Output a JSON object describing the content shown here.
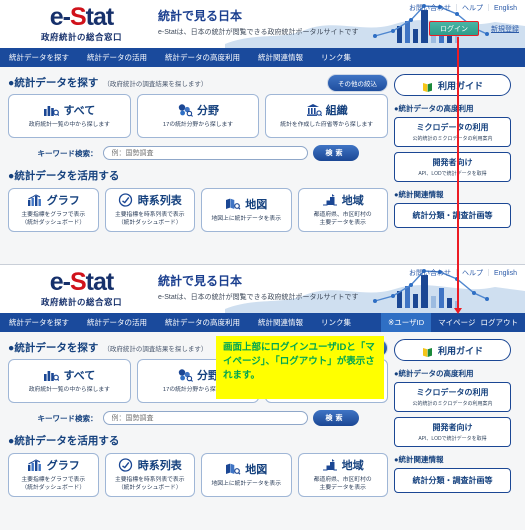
{
  "header": {
    "logo_main_pre": "e-",
    "logo_main_red": "S",
    "logo_main_post": "tat",
    "logo_sub": "政府統計の総合窓口",
    "title": "統計で見る日本",
    "subtitle": "e-Statは、日本の統計が閲覧できる政府統計ポータルサイトです",
    "toplinks": [
      "お問い合わせ",
      "ヘルプ",
      "English"
    ],
    "separator": "｜",
    "login_label": "ログイン",
    "signup_label": "新規登録"
  },
  "nav": {
    "items": [
      "統計データを探す",
      "統計データの活用",
      "統計データの高度利用",
      "統計関連情報",
      "リンク集"
    ],
    "user_id_label": "※ユーザID",
    "mypage_label": "マイページ",
    "logout_label": "ログアウト"
  },
  "search_section": {
    "heading_dot": "●",
    "heading": "統計データを探す",
    "note": "（政府統計の調査結果を探します）",
    "more_filter_label": "その他の絞込",
    "cards": [
      {
        "icon": "bar-chart-icon",
        "label": "すべて",
        "sub": "政府統計一覧の中から探します"
      },
      {
        "icon": "sectors-icon",
        "label": "分野",
        "sub": "17の統計分野から探します"
      },
      {
        "icon": "organization-icon",
        "label": "組織",
        "sub": "統計を作成した府省等から探します"
      }
    ],
    "keyword_label": "キーワード検索：",
    "keyword_value": "",
    "keyword_placeholder": "例：国勢調査",
    "search_button_label": "検索"
  },
  "utilize_section": {
    "heading_dot": "●",
    "heading": "統計データを活用する",
    "cards": [
      {
        "icon": "graph-icon",
        "label": "グラフ",
        "sub1": "主要指標をグラフで表示",
        "sub2": "（統計ダッシュボード）"
      },
      {
        "icon": "timeseries-icon",
        "label": "時系列表",
        "sub1": "主要指標を時系列表で表示",
        "sub2": "（統計ダッシュボード）"
      },
      {
        "icon": "map-icon",
        "label": "地図",
        "sub1": "地図上に統計データを表示",
        "sub2": ""
      },
      {
        "icon": "region-icon",
        "label": "地域",
        "sub1": "都道府県、市区町村の",
        "sub2": "主要データを表示"
      }
    ]
  },
  "sidebar": {
    "guide_label": "利用ガイド",
    "guide_icon": "book-icon",
    "section_advanced": "●統計データの高度利用",
    "cards_advanced": [
      {
        "title": "ミクロデータの利用",
        "sub": "公的統計のミクロデータの利用案内"
      },
      {
        "title": "開発者向け",
        "sub": "API、LODで統計データを取得"
      }
    ],
    "section_related": "●統計関連情報",
    "cards_related": [
      {
        "title": "統計分類・調査計画等",
        "sub": ""
      }
    ]
  },
  "annotation": {
    "callout_text": "画面上部にログインユーザIDと「マイページ」、「ログアウト」が表示されます。",
    "callout_bg": "#ffff00",
    "callout_color": "#00a651",
    "arrow_color": "#ec1c24",
    "highlight_color": "#ec1c24"
  },
  "colors": {
    "nav_blue": "#1a4a9c",
    "brand_blue": "#15417e",
    "brand_red": "#d0121b",
    "login_teal": "#2e9c8b",
    "page_bg": "#f5f6f7"
  }
}
